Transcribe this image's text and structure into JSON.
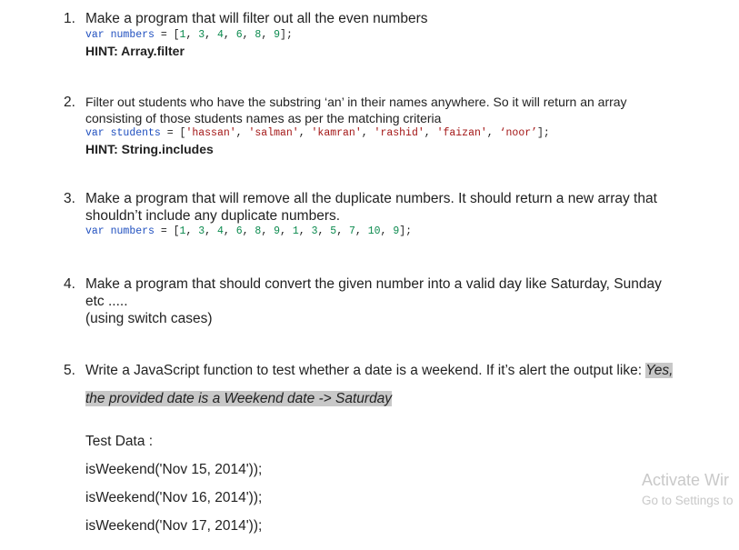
{
  "q1": {
    "number": "1.",
    "text": "Make a program that will filter out all the even numbers",
    "code": {
      "kw": "var",
      "name": "numbers",
      "eq": " = [",
      "vals": [
        "1",
        "3",
        "4",
        "6",
        "8",
        "9"
      ],
      "end": "];"
    },
    "hint": "HINT: Array.filter"
  },
  "q2": {
    "number": "2.",
    "line1": "Filter out students who have the substring ‘an’ in their names anywhere. So it will return an array",
    "line2": "consisting of those students names as per the matching criteria",
    "code": {
      "kw": "var",
      "name": "students",
      "eq": " = [",
      "vals": [
        "'hassan'",
        "'salman'",
        "'kamran'",
        "'rashid'",
        "'faizan'",
        "‘noor’"
      ],
      "end": "];"
    },
    "hint": "HINT: String.includes"
  },
  "q3": {
    "number": "3.",
    "line1": "Make a program that will remove all the duplicate numbers. It should return a new array that",
    "line2": "shouldn’t include any duplicate numbers.",
    "code": {
      "kw": "var",
      "name": "numbers",
      "eq": " = [",
      "vals": [
        "1",
        "3",
        "4",
        "6",
        "8",
        "9",
        "1",
        "3",
        "5",
        "7",
        "10",
        "9"
      ],
      "end": "];"
    }
  },
  "q4": {
    "number": "4.",
    "line1": "Make a program that should convert the given number into a valid day like Saturday, Sunday",
    "line2": "etc .....",
    "line3": "(using switch cases)"
  },
  "q5": {
    "number": "5.",
    "line1_plain": "Write a JavaScript function to test whether a date is a weekend. If it’s alert the output like: ",
    "line1_hl": "Yes,",
    "line2_hl": "the provided date is a Weekend date -> Saturday",
    "test_label": "Test Data :",
    "tests": [
      "isWeekend('Nov 15, 2014'));",
      "isWeekend('Nov 16, 2014'));",
      "isWeekend('Nov 17, 2014'));"
    ]
  },
  "watermark": {
    "line1": "Activate Wir",
    "line2": "Go to Settings to"
  }
}
